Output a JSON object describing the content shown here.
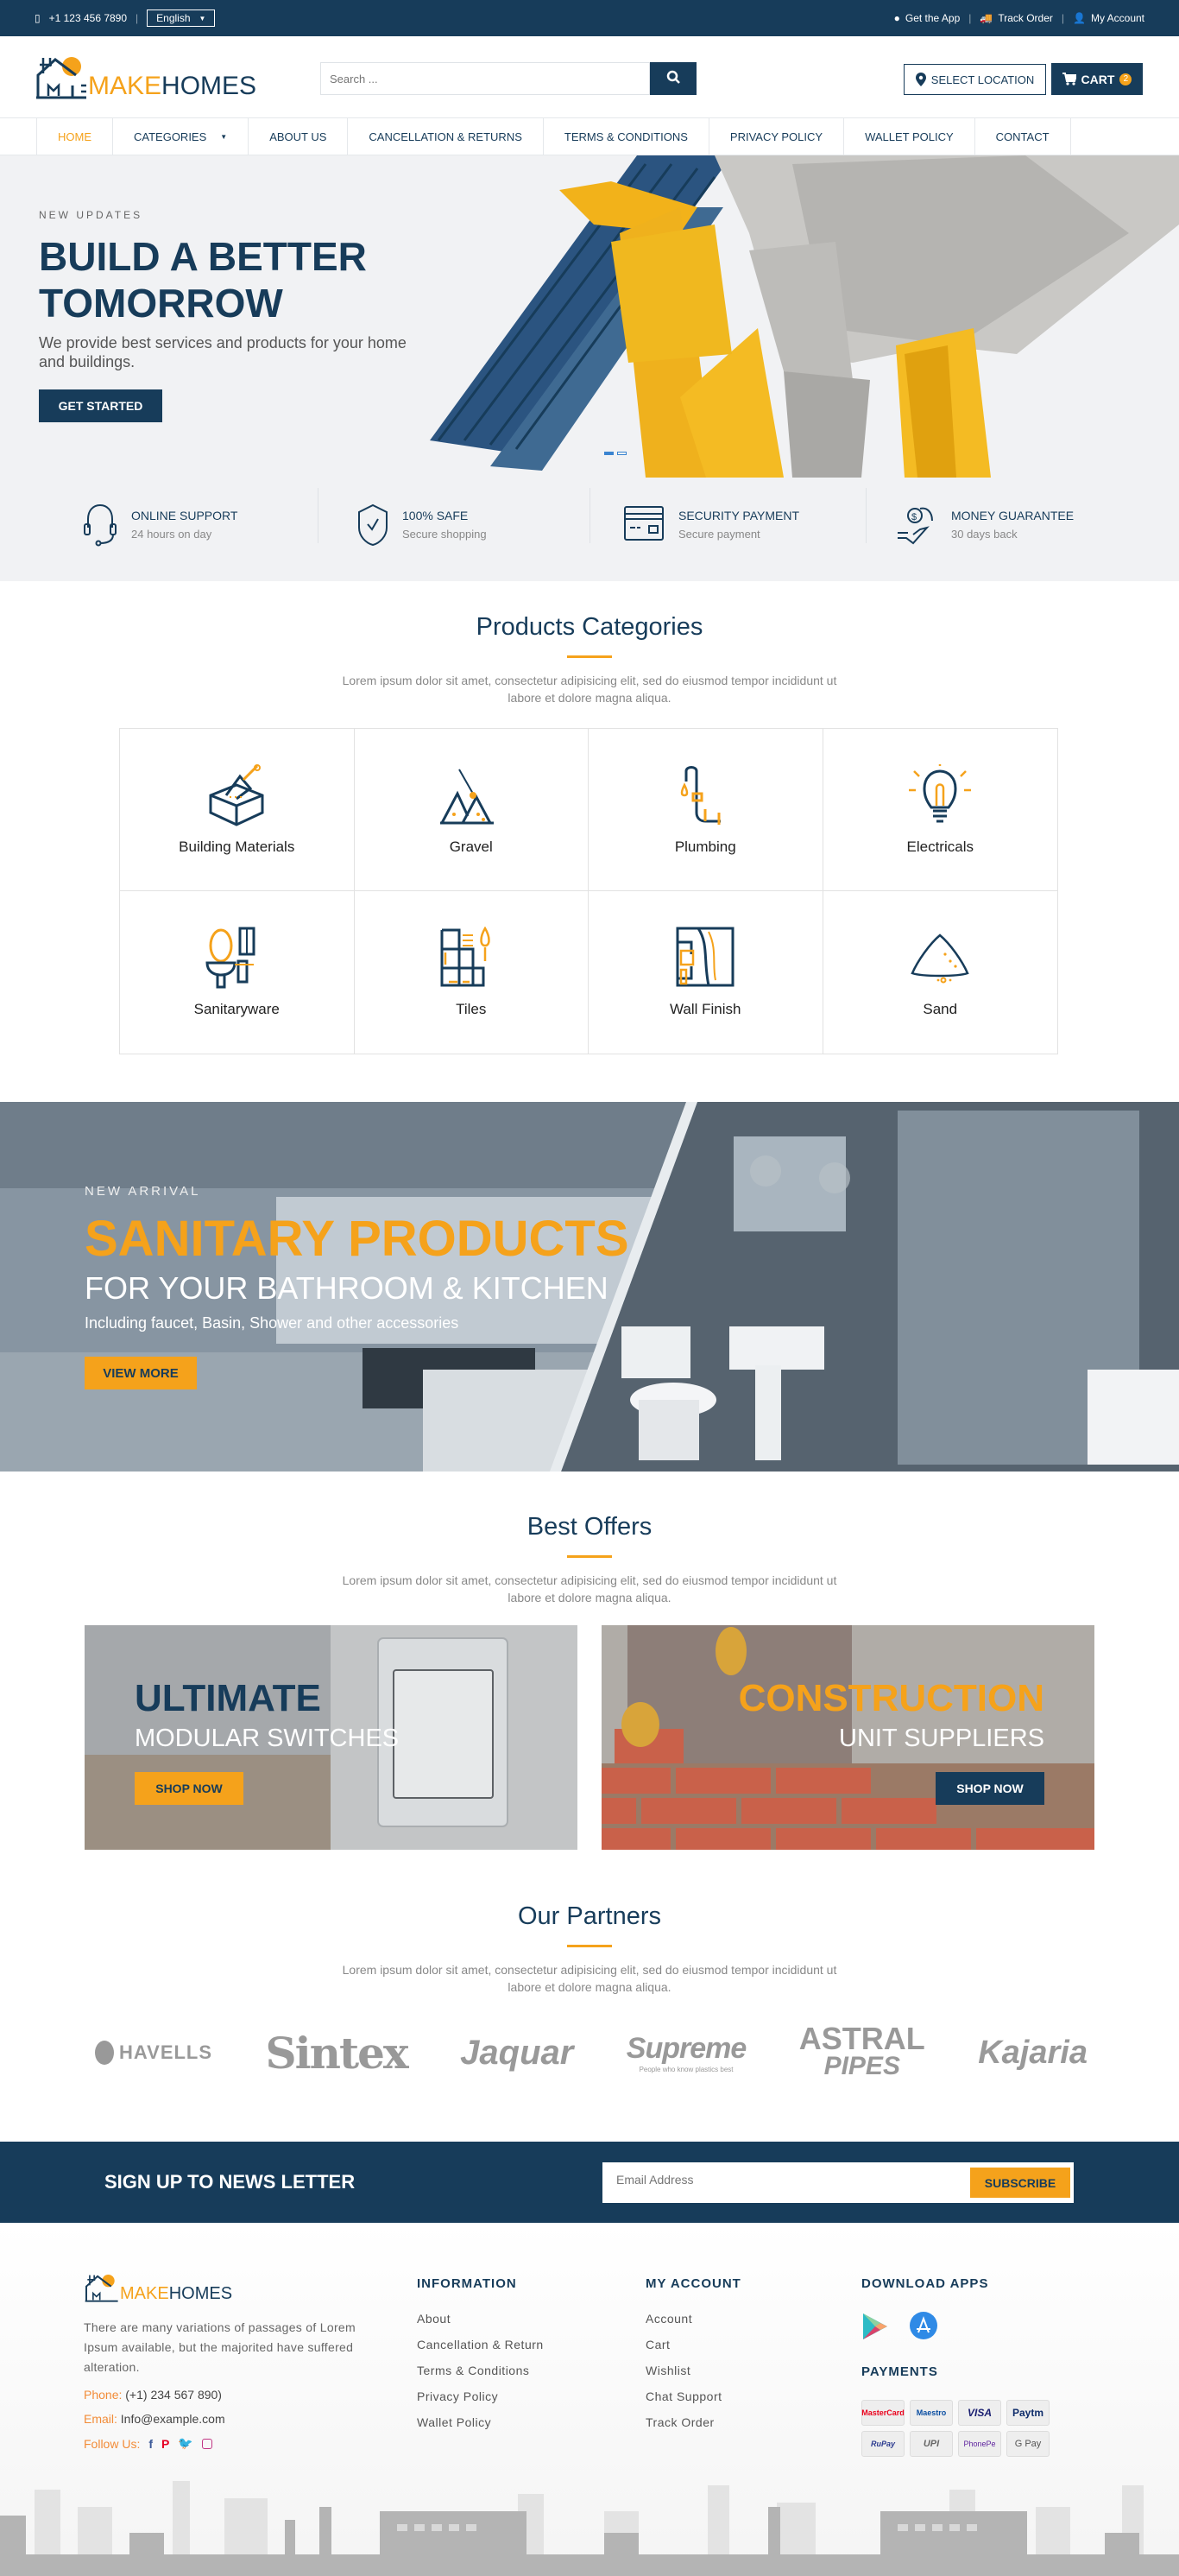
{
  "topbar": {
    "phone": "+1 123 456 7890",
    "language": "English",
    "get_app": "Get the App",
    "track_order": "Track Order",
    "my_account": "My Account"
  },
  "header": {
    "logo_make": "MAKE",
    "logo_homes": "HOMES",
    "search_placeholder": "Search ...",
    "select_location": "SELECT LOCATION",
    "cart_label": "CART",
    "cart_count": "2"
  },
  "nav": {
    "items": [
      {
        "label": "HOME"
      },
      {
        "label": "CATEGORIES"
      },
      {
        "label": "ABOUT US"
      },
      {
        "label": "CANCELLATION & RETURNS"
      },
      {
        "label": "TERMS & CONDITIONS"
      },
      {
        "label": "PRIVACY POLICY"
      },
      {
        "label": "WALLET POLICY"
      },
      {
        "label": "CONTACT"
      }
    ]
  },
  "hero": {
    "kicker": "NEW UPDATES",
    "title": "BUILD A BETTER TOMORROW",
    "subtitle": "We provide best services and products for your home and buildings.",
    "cta": "GET STARTED",
    "slide_count": 2,
    "active_slide": 1
  },
  "features": [
    {
      "title": "ONLINE SUPPORT",
      "sub": "24 hours on day",
      "icon": "headset-icon"
    },
    {
      "title": "100% SAFE",
      "sub": "Secure shopping",
      "icon": "shield-check-icon"
    },
    {
      "title": "SECURITY PAYMENT",
      "sub": "Secure payment",
      "icon": "credit-card-icon"
    },
    {
      "title": "MONEY GUARANTEE",
      "sub": "30 days back",
      "icon": "money-hand-icon"
    }
  ],
  "categories": {
    "title": "Products Categories",
    "desc": "Lorem ipsum dolor sit amet, consectetur adipisicing elit, sed do eiusmod tempor incididunt ut labore et dolore magna aliqua.",
    "items": [
      {
        "label": "Building Materials",
        "icon": "brick-trowel-icon"
      },
      {
        "label": "Gravel",
        "icon": "gravel-pile-icon"
      },
      {
        "label": "Plumbing",
        "icon": "faucet-pipe-icon"
      },
      {
        "label": "Electricals",
        "icon": "light-bulb-icon"
      },
      {
        "label": "Sanitaryware",
        "icon": "sink-mirror-icon"
      },
      {
        "label": "Tiles",
        "icon": "tiles-brush-icon"
      },
      {
        "label": "Wall Finish",
        "icon": "wall-finish-icon"
      },
      {
        "label": "Sand",
        "icon": "sand-pile-icon"
      }
    ]
  },
  "banner": {
    "kicker": "NEW ARRIVAL",
    "title": "SANITARY PRODUCTS",
    "subtitle": "FOR YOUR BATHROOM & KITCHEN",
    "desc": "Including faucet, Basin, Shower and other accessories",
    "cta": "VIEW MORE"
  },
  "offers": {
    "title": "Best Offers",
    "desc": "Lorem ipsum dolor sit amet, consectetur adipisicing elit, sed do eiusmod tempor incididunt ut labore et dolore magna aliqua.",
    "items": [
      {
        "title": "ULTIMATE",
        "subtitle": "MODULAR SWITCHES",
        "cta": "SHOP NOW"
      },
      {
        "title": "CONSTRUCTION",
        "subtitle": "UNIT SUPPLIERS",
        "cta": "SHOP NOW"
      }
    ]
  },
  "partners": {
    "title": "Our Partners",
    "desc": "Lorem ipsum dolor sit amet, consectetur adipisicing elit, sed do eiusmod tempor incididunt ut labore et dolore magna aliqua.",
    "logos": [
      "HAVELLS",
      "Sintex",
      "Jaquar",
      "Supreme",
      "ASTRAL",
      "Kajaria"
    ],
    "supreme_tag": "People who know plastics best",
    "astral_sub": "PIPES"
  },
  "newsletter": {
    "title": "SIGN UP TO NEWS LETTER",
    "placeholder": "Email Address",
    "button": "SUBSCRIBE"
  },
  "footer": {
    "about": "There are many variations of passages of Lorem Ipsum available, but the majorited have suffered alteration.",
    "phone_label": "Phone:",
    "phone": "(+1) 234 567 890)",
    "email_label": "Email:",
    "email": "Info@example.com",
    "follow_label": "Follow Us:",
    "info_title": "INFORMATION",
    "info_links": [
      "About",
      "Cancellation & Return",
      "Terms & Conditions",
      "Privacy Policy",
      "Wallet Policy"
    ],
    "account_title": "MY ACCOUNT",
    "account_links": [
      "Account",
      "Cart",
      "Wishlist",
      "Chat Support",
      "Track Order"
    ],
    "apps_title": "DOWNLOAD APPS",
    "payments_title": "PAYMENTS",
    "payments": [
      "MasterCard",
      "Maestro",
      "VISA",
      "Paytm",
      "RuPay",
      "UPI",
      "PhonePe",
      "G Pay"
    ]
  },
  "colors": {
    "primary": "#173c5a",
    "accent": "#f5a21b",
    "hero_bg": "#f1f2f4"
  }
}
